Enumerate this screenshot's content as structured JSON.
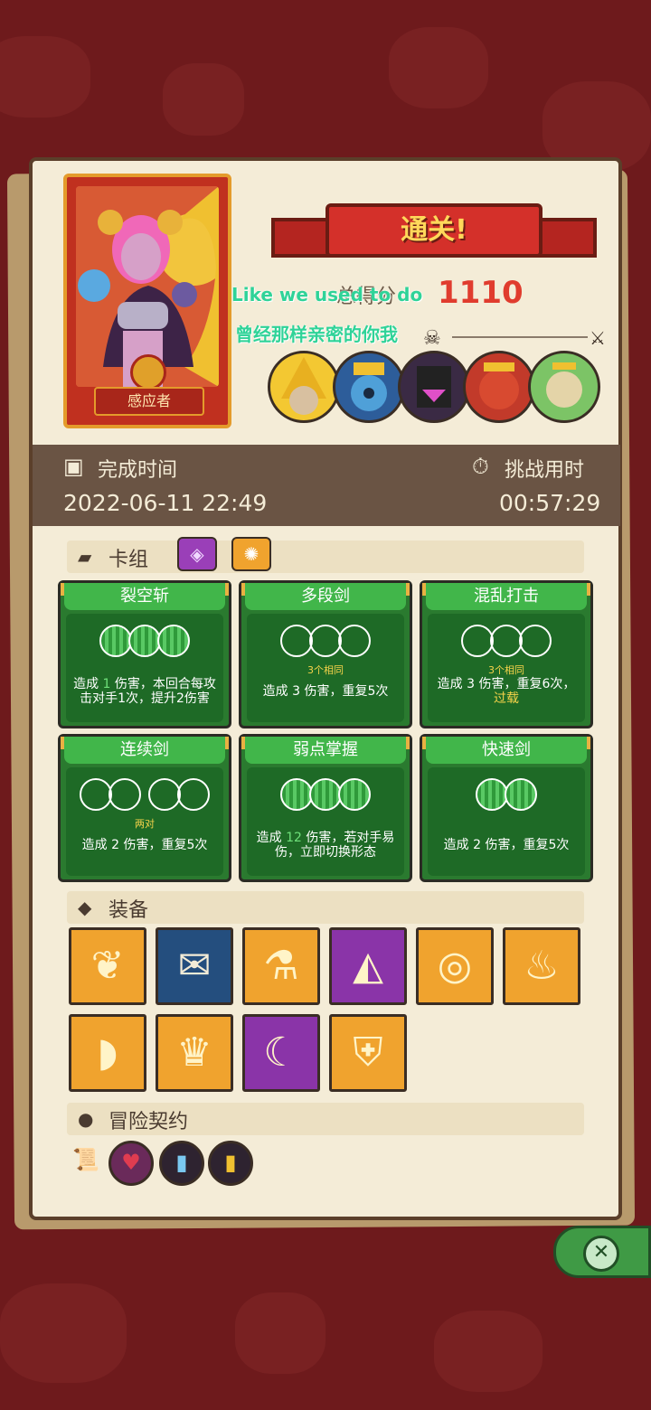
{
  "character": {
    "name": "感应者"
  },
  "banner": {
    "title": "通关!"
  },
  "score": {
    "label": "总得分",
    "value": "1110"
  },
  "overlay_lyrics": [
    "Like we used to do",
    "曾经那样亲密的你我"
  ],
  "time": {
    "finish_label": "完成时间",
    "finish_value": "2022-06-11 22:49",
    "duration_label": "挑战用时",
    "duration_value": "00:57:29"
  },
  "deck": {
    "title": "卡组",
    "cards": [
      {
        "name": "裂空斩",
        "slots": [
          "filled",
          "filled",
          "filled"
        ],
        "req": "",
        "desc": [
          "造成 ",
          "1",
          " 伤害，本回合每攻击对手1次，提升2伤害"
        ]
      },
      {
        "name": "多段剑",
        "slots": [
          "empty",
          "empty",
          "empty"
        ],
        "req": "3个相同",
        "desc": [
          "造成 ",
          "3",
          " 伤害，重复5次"
        ]
      },
      {
        "name": "混乱打击",
        "slots": [
          "empty",
          "empty",
          "empty"
        ],
        "req": "3个相同",
        "desc": [
          "造成 ",
          "3",
          " 伤害，重复6次，",
          "过载"
        ]
      },
      {
        "name": "连续剑",
        "slots": [
          "empty",
          "empty",
          "empty",
          "empty"
        ],
        "req": "两对",
        "desc": [
          "造成 ",
          "2",
          " 伤害，重复5次"
        ]
      },
      {
        "name": "弱点掌握",
        "slots": [
          "filled",
          "filled",
          "filled"
        ],
        "req": "",
        "desc": [
          "造成 ",
          "12",
          " 伤害，若对手易伤，立即切换形态"
        ]
      },
      {
        "name": "快速剑",
        "slots": [
          "filled",
          "filled"
        ],
        "req": "",
        "desc": [
          "造成 ",
          "2",
          " 伤害，重复5次"
        ]
      }
    ]
  },
  "equipment": {
    "title": "装备",
    "items": [
      {
        "icon": "feather-icon",
        "rarity": "orange"
      },
      {
        "icon": "scroll-icon",
        "rarity": "blue"
      },
      {
        "icon": "potion-icon",
        "rarity": "orange"
      },
      {
        "icon": "horn-icon",
        "rarity": "purple"
      },
      {
        "icon": "ring-icon",
        "rarity": "orange"
      },
      {
        "icon": "flame-icon",
        "rarity": "orange"
      },
      {
        "icon": "cornucopia-icon",
        "rarity": "orange"
      },
      {
        "icon": "crown-icon",
        "rarity": "orange"
      },
      {
        "icon": "blade-icon",
        "rarity": "purple"
      },
      {
        "icon": "shield-icon",
        "rarity": "orange"
      }
    ]
  },
  "contracts": {
    "title": "冒险契约",
    "items": [
      "scroll-icon",
      "heart-icon",
      "bottle-icon",
      "bottle-gold-icon"
    ]
  },
  "colors": {
    "accent_red": "#e03c2e",
    "card_green": "#2a7a2f",
    "highlight_yellow": "#f5d34a",
    "lyric_green": "#2fd398"
  }
}
